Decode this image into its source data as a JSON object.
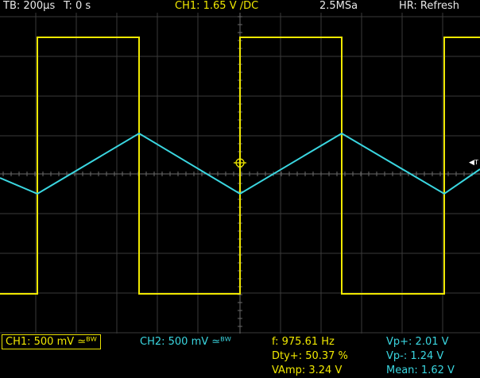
{
  "header": {
    "timebase": "TB: 200µs",
    "trigger_time": "T: 0 s",
    "ch1_trigger": "CH1: 1.65 V ∕DC",
    "sample_rate": "2.5MSa",
    "acq_mode": "HR: Refresh"
  },
  "channels": {
    "ch1": {
      "label": "CH1: 500 mV ≃ᴮᵂ",
      "color": "#f0e800"
    },
    "ch2": {
      "label": "CH2: 500 mV ≃ᴮᵂ",
      "color": "#3ad6e0"
    }
  },
  "measurements": {
    "freq": "f: 975.61 Hz",
    "duty": "Dty+: 50.37 %",
    "vamp": "VAmp: 3.24 V",
    "vpp": "Vp+: 2.01 V",
    "vpm": "Vp-: 1.24 V",
    "mean": "Mean: 1.62 V"
  },
  "trigger_marker_label": "T"
}
